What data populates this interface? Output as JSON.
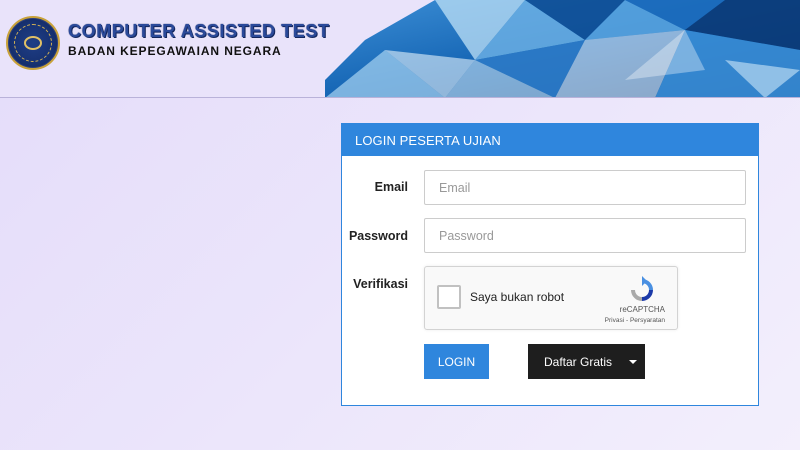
{
  "header": {
    "title": "COMPUTER ASSISTED TEST",
    "subtitle": "BADAN KEPEGAWAIAN NEGARA"
  },
  "login_panel": {
    "heading": "LOGIN PESERTA UJIAN",
    "email": {
      "label": "Email",
      "placeholder": "Email",
      "value": ""
    },
    "password": {
      "label": "Password",
      "placeholder": "Password",
      "value": ""
    },
    "verification": {
      "label": "Verifikasi",
      "captcha_text": "Saya bukan robot",
      "captcha_brand": "reCAPTCHA",
      "captcha_links": "Privasi - Persyaratan",
      "checked": false
    },
    "login_button": "LOGIN",
    "register_button": "Daftar Gratis"
  },
  "colors": {
    "accent": "#2f86dd",
    "page_background": "#ece6fb",
    "register_button": "#1e1e1e"
  }
}
